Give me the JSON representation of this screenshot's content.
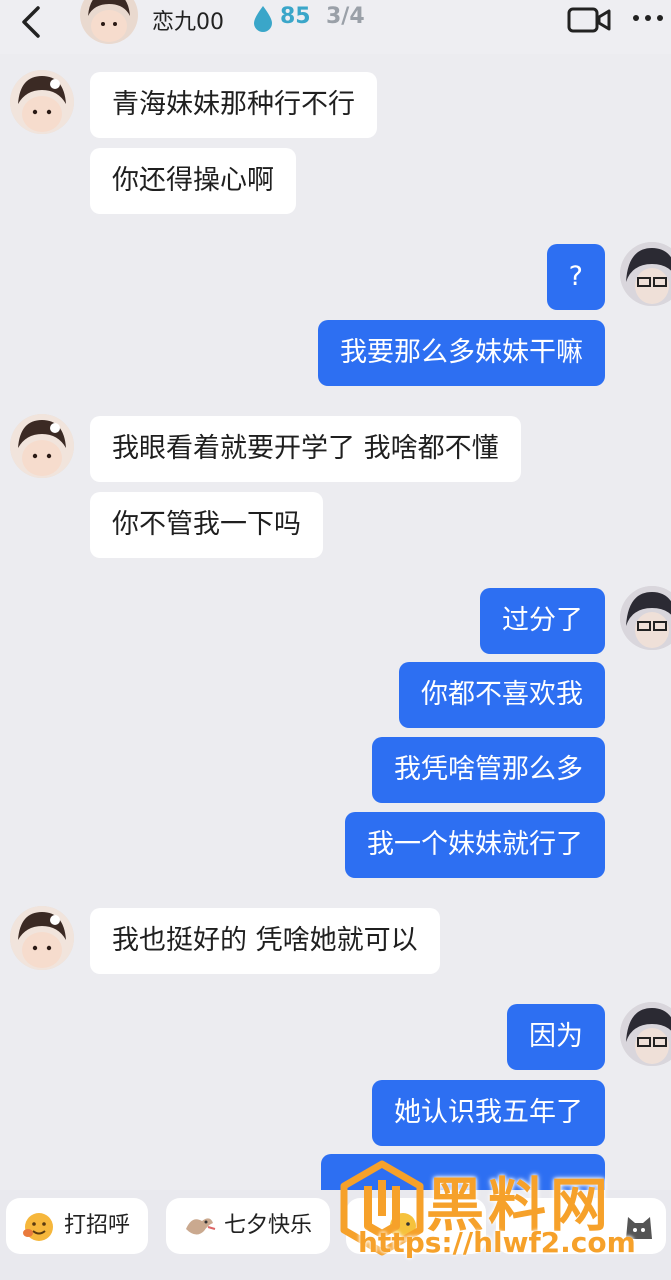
{
  "header": {
    "contact_name": "恋九00",
    "score": "85",
    "pager": "3/4"
  },
  "messages": [
    {
      "side": "left",
      "text": "青海妹妹那种行不行"
    },
    {
      "side": "left",
      "text": "你还得操心啊"
    },
    {
      "side": "right",
      "text": "?"
    },
    {
      "side": "right",
      "text": "我要那么多妹妹干嘛"
    },
    {
      "side": "left",
      "text": "我眼看着就要开学了 我啥都不懂"
    },
    {
      "side": "left",
      "text": "你不管我一下吗"
    },
    {
      "side": "right",
      "text": "过分了"
    },
    {
      "side": "right",
      "text": "你都不喜欢我"
    },
    {
      "side": "right",
      "text": "我凭啥管那么多"
    },
    {
      "side": "right",
      "text": "我一个妹妹就行了"
    },
    {
      "side": "left",
      "text": "我也挺好的 凭啥她就可以"
    },
    {
      "side": "right",
      "text": "因为"
    },
    {
      "side": "right",
      "text": "她认识我五年了"
    }
  ],
  "quick_replies": [
    {
      "label": "打招呼"
    },
    {
      "label": "七夕快乐"
    }
  ],
  "watermark": {
    "title": "黑料网",
    "url": "https://hlwf2.com"
  },
  "colors": {
    "background": "#ececf0",
    "sent_bubble": "#2d6ff2",
    "received_bubble": "#ffffff",
    "watermark": "#f6a12a"
  }
}
